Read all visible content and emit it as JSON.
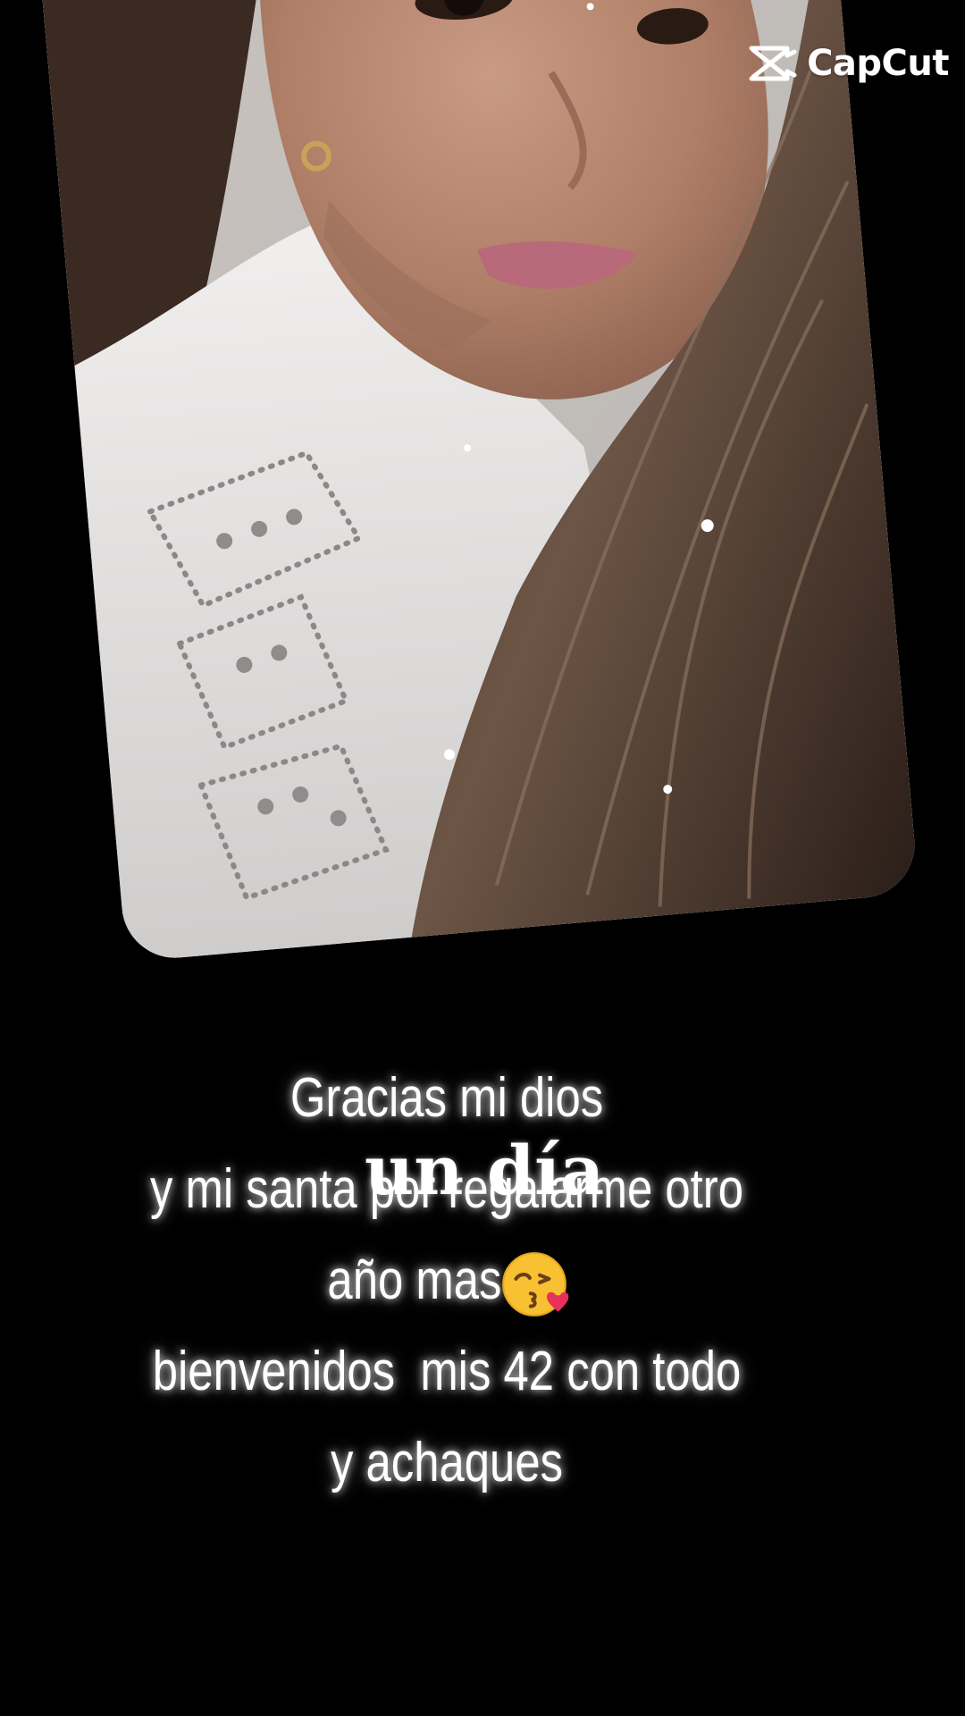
{
  "watermark": {
    "brand": "CapCut",
    "icon": "capcut-logo-icon"
  },
  "photo": {
    "subject": "selfie-photo",
    "card_color": "#d8d6d4"
  },
  "caption": {
    "lines": [
      "Gracias mi dios",
      "y mi santa por regalarme otro",
      "año mas",
      "bienvenidos  mis 42 con todo",
      "y achaques"
    ],
    "emoji": "kissing-face-with-heart-icon"
  },
  "overlay": {
    "text": "un día"
  },
  "colors": {
    "background": "#000000",
    "text": "#ffffff"
  }
}
